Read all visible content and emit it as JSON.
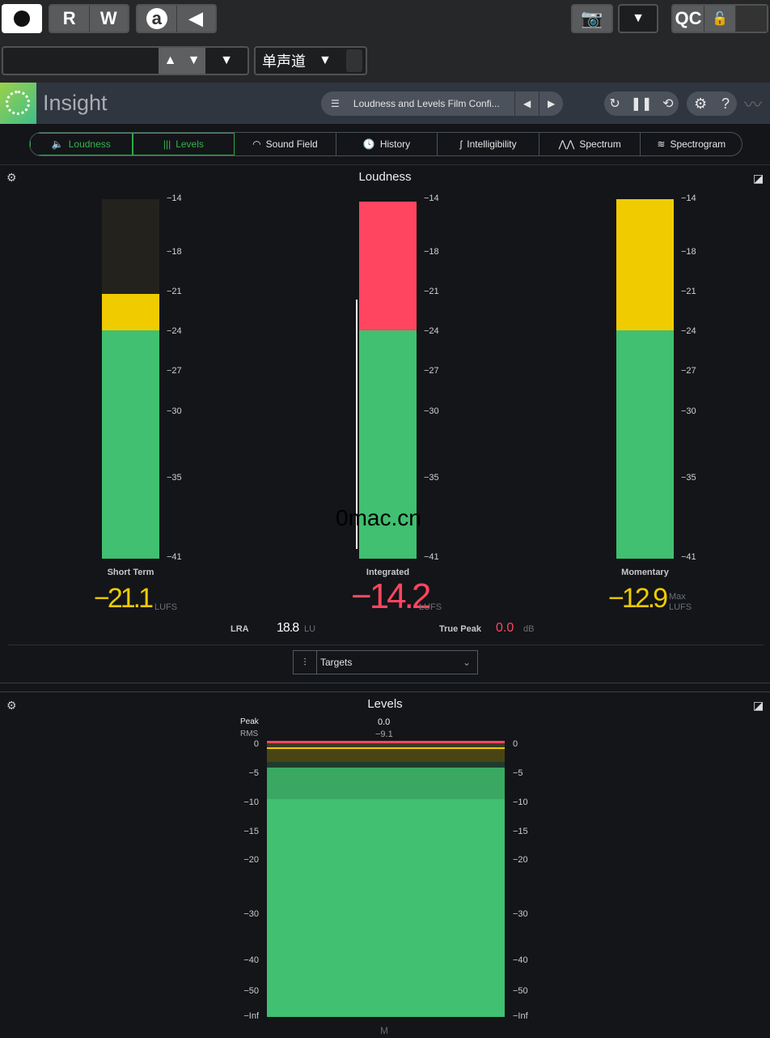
{
  "host": {
    "rw": [
      "R",
      "W"
    ],
    "a_label": "a",
    "qc": "QC",
    "channel": "单声道",
    "track_input": ""
  },
  "header": {
    "app_name": "Insight",
    "preset": "Loudness and Levels Film Confi..."
  },
  "tabs": [
    {
      "label": "Loudness",
      "icon": "speaker-icon",
      "active": true
    },
    {
      "label": "Levels",
      "icon": "levels-icon",
      "active": true
    },
    {
      "label": "Sound Field",
      "icon": "sound-field-icon"
    },
    {
      "label": "History",
      "icon": "history-icon"
    },
    {
      "label": "Intelligibility",
      "icon": "ear-icon"
    },
    {
      "label": "Spectrum",
      "icon": "spectrum-icon"
    },
    {
      "label": "Spectrogram",
      "icon": "spectrogram-icon"
    }
  ],
  "loudness": {
    "title": "Loudness",
    "scale": [
      "−14",
      "−18",
      "−21",
      "−24",
      "−27",
      "−30",
      "−35",
      "−41"
    ],
    "meters": [
      {
        "name": "Short Term",
        "value": "−21.1",
        "unit": "LUFS",
        "level": -21.1,
        "color": "#f0cb00"
      },
      {
        "name": "Integrated",
        "value": "−14.2",
        "unit": "LUFS",
        "level": -14.2,
        "color": "#ff4560"
      },
      {
        "name": "Momentary",
        "value": "−12.9",
        "unit_top": "Max",
        "unit": "LUFS",
        "level": -12.9,
        "color": "#f0cb00"
      }
    ],
    "lra_label": "LRA",
    "lra_value": "18.8",
    "lra_unit": "LU",
    "tp_label": "True Peak",
    "tp_value": "0.0",
    "tp_unit": "dB",
    "targets": "Targets"
  },
  "levels": {
    "title": "Levels",
    "peak_label": "Peak",
    "peak_value": "0.0",
    "rms_label": "RMS",
    "rms_value": "−9.1",
    "scale": [
      "0",
      "−5",
      "−10",
      "−15",
      "−20",
      "−30",
      "−40",
      "−50",
      "−Inf"
    ],
    "channel": "M"
  },
  "watermark": "0mac.cn",
  "colors": {
    "green": "#40c070",
    "yellow": "#f0cb00",
    "red": "#ff4560",
    "accent": "#35b34f"
  }
}
